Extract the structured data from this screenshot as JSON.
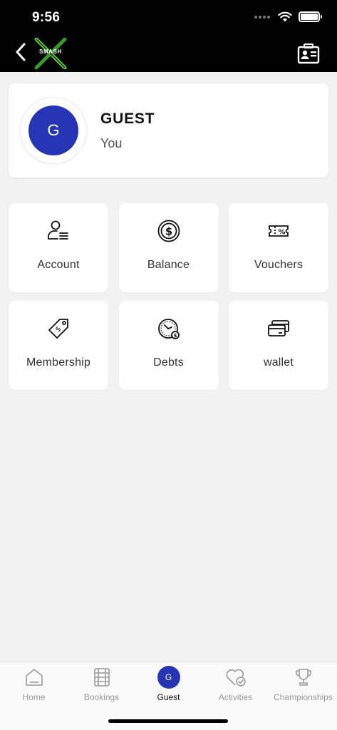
{
  "status_bar": {
    "time": "9:56"
  },
  "header": {
    "logo_text": "SMASH",
    "back_icon": "chevron-left-icon",
    "right_icon": "id-card-icon"
  },
  "profile": {
    "initial": "G",
    "name": "GUEST",
    "subtitle": "You"
  },
  "tiles": [
    {
      "label": "Account",
      "icon": "account-icon"
    },
    {
      "label": "Balance",
      "icon": "dollar-coin-icon"
    },
    {
      "label": "Vouchers",
      "icon": "voucher-ticket-icon"
    },
    {
      "label": "Membership",
      "icon": "price-tag-icon"
    },
    {
      "label": "Debts",
      "icon": "debt-clock-icon"
    },
    {
      "label": "wallet",
      "icon": "wallet-cards-icon"
    }
  ],
  "tab_bar": {
    "tabs": [
      {
        "label": "Home",
        "icon": "home-icon"
      },
      {
        "label": "Bookings",
        "icon": "bookings-icon"
      },
      {
        "label": "Guest",
        "icon": "avatar",
        "initial": "G",
        "active": true
      },
      {
        "label": "Activities",
        "icon": "heart-check-icon"
      },
      {
        "label": "Championships",
        "icon": "trophy-icon"
      }
    ]
  },
  "colors": {
    "accent": "#2535b3",
    "logo_green": "#5fd33b",
    "header_bg": "#000000",
    "page_bg": "#f2f2f2"
  }
}
